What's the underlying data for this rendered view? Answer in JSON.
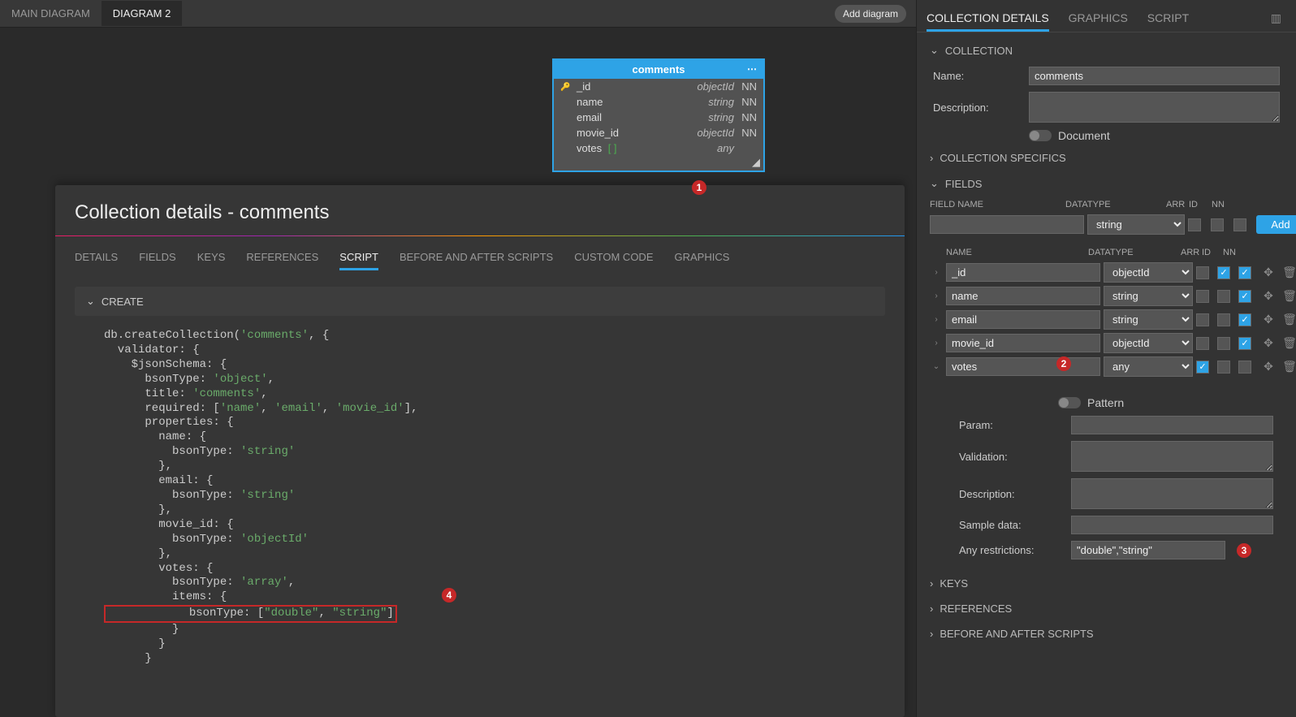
{
  "topTabs": {
    "main": "MAIN DIAGRAM",
    "d2": "DIAGRAM 2"
  },
  "addDiagram": "Add diagram",
  "entity": {
    "title": "comments",
    "rows": [
      {
        "name": "_id",
        "type": "objectId",
        "nn": "NN",
        "key": true
      },
      {
        "name": "name",
        "type": "string",
        "nn": "NN"
      },
      {
        "name": "email",
        "type": "string",
        "nn": "NN"
      },
      {
        "name": "movie_id",
        "type": "objectId",
        "nn": "NN"
      },
      {
        "name": "votes [ ]",
        "type": "any",
        "nn": ""
      }
    ]
  },
  "detailsTitle": "Collection details - comments",
  "detailTabs": {
    "details": "DETAILS",
    "fields": "FIELDS",
    "keys": "KEYS",
    "refs": "REFERENCES",
    "script": "SCRIPT",
    "before": "BEFORE AND AFTER SCRIPTS",
    "custom": "CUSTOM CODE",
    "graphics": "GRAPHICS"
  },
  "createLabel": "CREATE",
  "code": {
    "l1a": "db.createCollection(",
    "l1b": "'comments'",
    "l1c": ", {",
    "l2": "  validator: {",
    "l3": "    $jsonSchema: {",
    "l4a": "      bsonType: ",
    "l4b": "'object'",
    "l4c": ",",
    "l5a": "      title: ",
    "l5b": "'comments'",
    "l5c": ",",
    "l6a": "      required: [",
    "l6b": "'name'",
    "l6c": ", ",
    "l6d": "'email'",
    "l6e": ", ",
    "l6f": "'movie_id'",
    "l6g": "],",
    "l7": "      properties: {",
    "l8": "        name: {",
    "l9a": "          bsonType: ",
    "l9b": "'string'",
    "l10": "        },",
    "l11": "        email: {",
    "l12a": "          bsonType: ",
    "l12b": "'string'",
    "l13": "        },",
    "l14": "        movie_id: {",
    "l15a": "          bsonType: ",
    "l15b": "'objectId'",
    "l16": "        },",
    "l17": "        votes: {",
    "l18a": "          bsonType: ",
    "l18b": "'array'",
    "l18c": ",",
    "l19": "          items: {",
    "l20a": "            bsonType: [",
    "l20b": "\"double\"",
    "l20c": ", ",
    "l20d": "\"string\"",
    "l20e": "]",
    "l21": "          }",
    "l22": "        }",
    "l23": "      }"
  },
  "sidebar": {
    "tabs": {
      "coll": "COLLECTION DETAILS",
      "gfx": "GRAPHICS",
      "script": "SCRIPT"
    },
    "sections": {
      "collection": "COLLECTION",
      "specifics": "COLLECTION SPECIFICS",
      "fields": "FIELDS",
      "keys": "KEYS",
      "references": "REFERENCES",
      "before": "BEFORE AND AFTER SCRIPTS"
    },
    "labels": {
      "name": "Name:",
      "desc": "Description:",
      "document": "Document",
      "fieldName": "FIELD NAME",
      "datatype": "DATATYPE",
      "arr": "ARR",
      "id": "ID",
      "nn": "NN",
      "name2": "NAME",
      "param": "Param:",
      "validation": "Validation:",
      "description": "Description:",
      "sample": "Sample data:",
      "anyRestrictions": "Any restrictions:",
      "pattern": "Pattern",
      "add": "Add"
    },
    "nameValue": "comments",
    "newFieldType": "string",
    "anyRestrictionsValue": "\"double\",\"string\"",
    "fieldRows": [
      {
        "name": "_id",
        "type": "objectId",
        "arr": false,
        "id": true,
        "nn": true,
        "expand": ">"
      },
      {
        "name": "name",
        "type": "string",
        "arr": false,
        "id": false,
        "nn": true,
        "expand": ">"
      },
      {
        "name": "email",
        "type": "string",
        "arr": false,
        "id": false,
        "nn": true,
        "expand": ">"
      },
      {
        "name": "movie_id",
        "type": "objectId",
        "arr": false,
        "id": false,
        "nn": true,
        "expand": ">"
      },
      {
        "name": "votes",
        "type": "any",
        "arr": true,
        "id": false,
        "nn": false,
        "expand": "v"
      }
    ]
  },
  "badges": {
    "b1": "1",
    "b2": "2",
    "b3": "3",
    "b4": "4"
  }
}
